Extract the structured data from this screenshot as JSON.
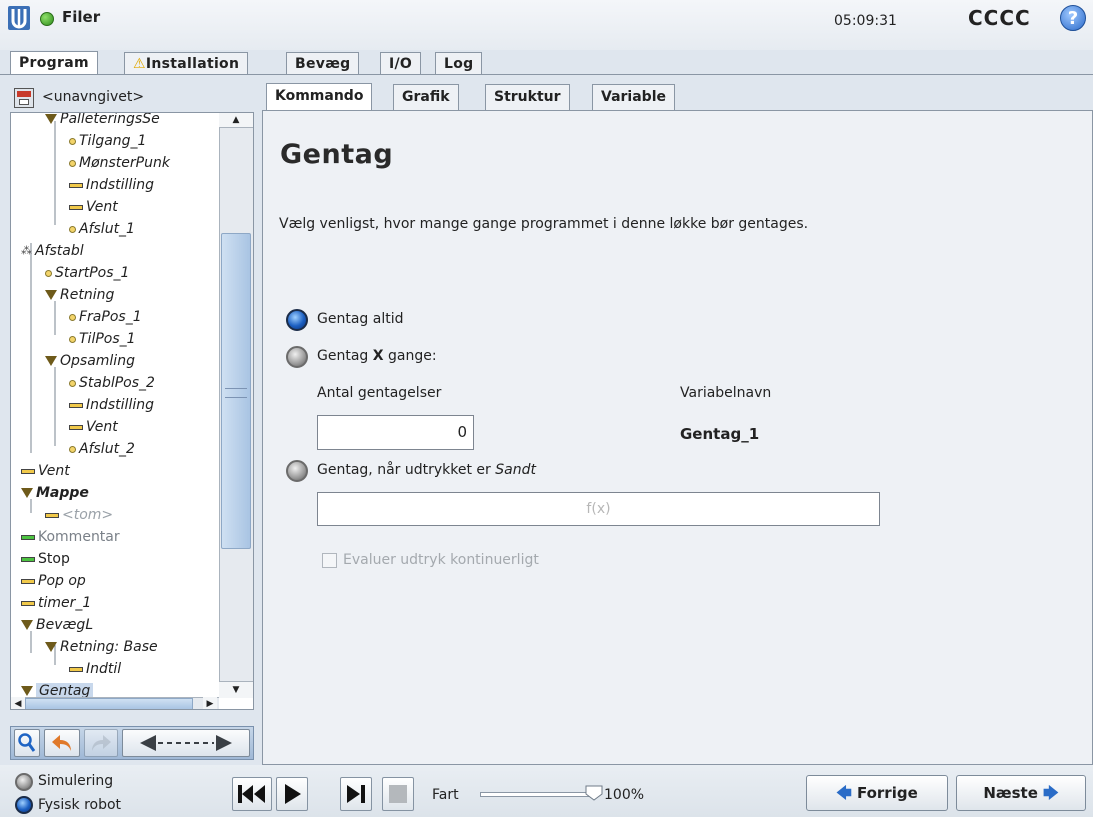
{
  "header": {
    "file_menu": "Filer",
    "clock": "05:09:31",
    "robot_name": "CCCC",
    "help": "?"
  },
  "main_tabs": [
    {
      "label": "Program",
      "active": true
    },
    {
      "label": "Installation",
      "warning": true
    },
    {
      "label": "Bevæg"
    },
    {
      "label": "I/O"
    },
    {
      "label": "Log"
    }
  ],
  "program": {
    "name": "<unavngivet>"
  },
  "tree": [
    {
      "label": "PalleteringsSe",
      "icon": "triangle",
      "indent": 1
    },
    {
      "label": "Tilgang_1",
      "icon": "dot",
      "indent": 2
    },
    {
      "label": "MønsterPunk",
      "icon": "dot",
      "indent": 2
    },
    {
      "label": "Indstilling",
      "icon": "bar",
      "indent": 2
    },
    {
      "label": "Vent",
      "icon": "bar",
      "indent": 2
    },
    {
      "label": "Afslut_1",
      "icon": "dot",
      "indent": 2
    },
    {
      "label": "Afstabl",
      "icon": "multi",
      "indent": 0
    },
    {
      "label": "StartPos_1",
      "icon": "dot",
      "indent": 1
    },
    {
      "label": "Retning",
      "icon": "triangle",
      "indent": 1
    },
    {
      "label": "FraPos_1",
      "icon": "dot",
      "indent": 2
    },
    {
      "label": "TilPos_1",
      "icon": "dot",
      "indent": 2
    },
    {
      "label": "Opsamling",
      "icon": "triangle",
      "indent": 1
    },
    {
      "label": "StablPos_2",
      "icon": "dot",
      "indent": 2
    },
    {
      "label": "Indstilling",
      "icon": "bar",
      "indent": 2
    },
    {
      "label": "Vent",
      "icon": "bar",
      "indent": 2
    },
    {
      "label": "Afslut_2",
      "icon": "dot",
      "indent": 2
    },
    {
      "label": "Vent",
      "icon": "bar",
      "indent": 0
    },
    {
      "label": "Mappe",
      "icon": "triangle",
      "indent": 0,
      "bold": true
    },
    {
      "label": "<tom>",
      "icon": "bar",
      "indent": 1,
      "muted": true
    },
    {
      "label": "Kommentar",
      "icon": "bar-green",
      "indent": 0,
      "muted": true,
      "upright": true
    },
    {
      "label": "Stop",
      "icon": "bar-green",
      "indent": 0,
      "upright": true
    },
    {
      "label": "Pop op",
      "icon": "bar",
      "indent": 0
    },
    {
      "label": "timer_1",
      "icon": "bar",
      "indent": 0
    },
    {
      "label": "BevægL",
      "icon": "triangle",
      "indent": 0
    },
    {
      "label": "Retning: Base",
      "icon": "triangle",
      "indent": 1
    },
    {
      "label": "Indtil",
      "icon": "bar",
      "indent": 2
    },
    {
      "label": "Gentag",
      "icon": "triangle",
      "indent": 0,
      "selected": true
    }
  ],
  "sub_tabs": [
    {
      "label": "Kommando",
      "active": true
    },
    {
      "label": "Grafik"
    },
    {
      "label": "Struktur"
    },
    {
      "label": "Variable"
    }
  ],
  "command": {
    "title": "Gentag",
    "description": "Vælg venligst, hvor mange gange programmet i denne løkke bør gentages.",
    "option_always": "Gentag altid",
    "option_x_pre": "Gentag ",
    "option_x_bold": "X",
    "option_x_post": " gange:",
    "count_label": "Antal gentagelser",
    "count_value": "0",
    "varname_label": "Variabelnavn",
    "varname_value": "Gentag_1",
    "option_expr_pre": "Gentag, når udtrykket er ",
    "option_expr_italic": "Sandt",
    "expr_placeholder": "f(x)",
    "continuous_label": "Evaluer udtryk kontinuerligt",
    "selected_option": "always"
  },
  "footer": {
    "simulation": "Simulering",
    "physical": "Fysisk robot",
    "speed_label": "Fart",
    "speed_value": "100%",
    "prev": "Forrige",
    "next": "Næste"
  }
}
